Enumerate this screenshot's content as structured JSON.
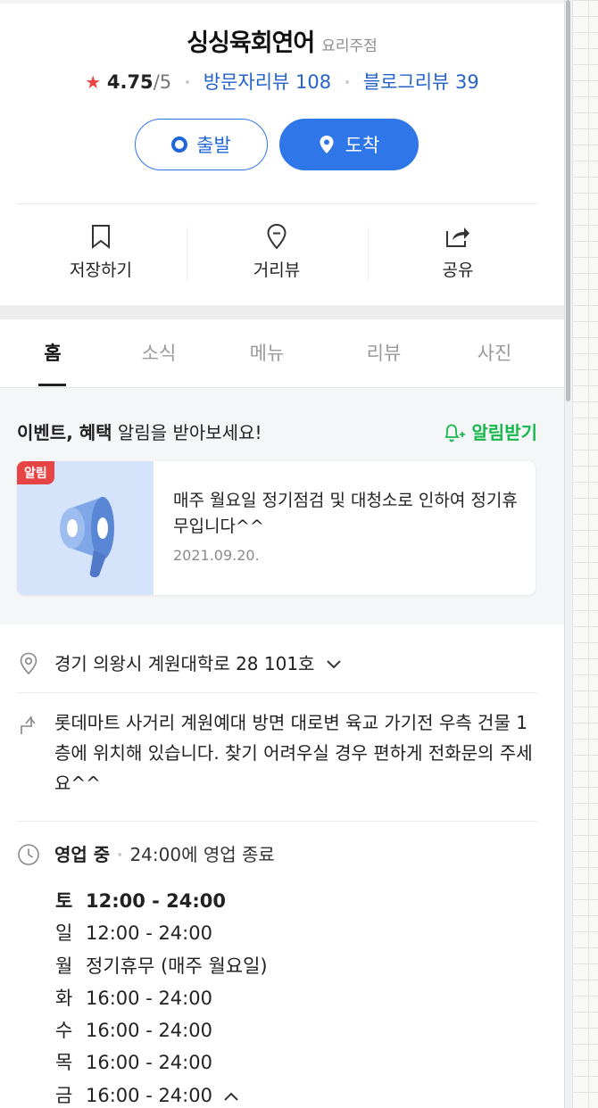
{
  "place": {
    "name": "싱싱육회연어",
    "category": "요리주점",
    "rating": "4.75",
    "rating_max": "/5",
    "visitor_reviews": "방문자리뷰 108",
    "blog_reviews": "블로그리뷰 39"
  },
  "route": {
    "start_label": "출발",
    "arrive_label": "도착"
  },
  "actions": {
    "save": "저장하기",
    "street_view": "거리뷰",
    "share": "공유"
  },
  "tabs": [
    "홈",
    "소식",
    "메뉴",
    "리뷰",
    "사진"
  ],
  "notice": {
    "heading_bold": "이벤트, 혜택",
    "heading_rest": " 알림을 받아보세요!",
    "alarm_button": "알림받기",
    "badge": "알림",
    "text": "매주 월요일 정기점검 및 대청소로 인하여 정기휴무입니다^^",
    "date": "2021.09.20."
  },
  "info": {
    "address": "경기 의왕시 계원대학로 28 101호",
    "directions": "롯데마트 사거리 계원예대 방면 대로변 육교 가기전 우측 건물 1층에 위치해 있습니다. 찾기 어려우실 경우 편하게 전화문의 주세요^^",
    "open_status": "영업 중",
    "open_detail": "24:00에 영업 종료"
  },
  "hours": [
    {
      "day": "토",
      "time": "12:00 - 24:00"
    },
    {
      "day": "일",
      "time": "12:00 - 24:00"
    },
    {
      "day": "월",
      "time": "정기휴무 (매주 월요일)"
    },
    {
      "day": "화",
      "time": "16:00 - 24:00"
    },
    {
      "day": "수",
      "time": "16:00 - 24:00"
    },
    {
      "day": "목",
      "time": "16:00 - 24:00"
    },
    {
      "day": "금",
      "time": "16:00 - 24:00"
    }
  ],
  "colors": {
    "accent": "#2f77e8",
    "alarm": "#16b74d",
    "star": "#e84444",
    "badge": "#e74545"
  }
}
